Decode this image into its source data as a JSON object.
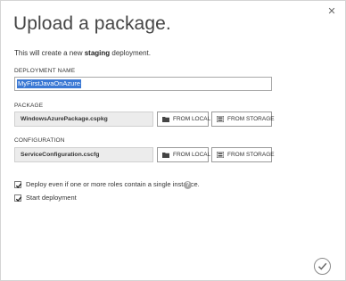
{
  "dialog": {
    "title": "Upload a package.",
    "subtitle_prefix": "This will create a new ",
    "subtitle_bold": "staging",
    "subtitle_suffix": " deployment.",
    "close_icon": "close-icon"
  },
  "deployment_name": {
    "label": "DEPLOYMENT NAME",
    "value": "MyFirstJavaOnAzure"
  },
  "package": {
    "label": "PACKAGE",
    "file": "WindowsAzurePackage.cspkg",
    "from_local": "FROM LOCAL",
    "from_storage": "FROM STORAGE"
  },
  "configuration": {
    "label": "CONFIGURATION",
    "file": "ServiceConfiguration.cscfg",
    "from_local": "FROM LOCAL",
    "from_storage": "FROM STORAGE"
  },
  "options": {
    "deploy_single_instance": {
      "label": "Deploy even if one or more roles contain a single instance.",
      "checked": true
    },
    "start_deployment": {
      "label": "Start deployment",
      "checked": true
    },
    "help_icon": "?"
  },
  "colors": {
    "selection": "#3a78d4",
    "field_bg": "#ececec",
    "text": "#333333"
  }
}
